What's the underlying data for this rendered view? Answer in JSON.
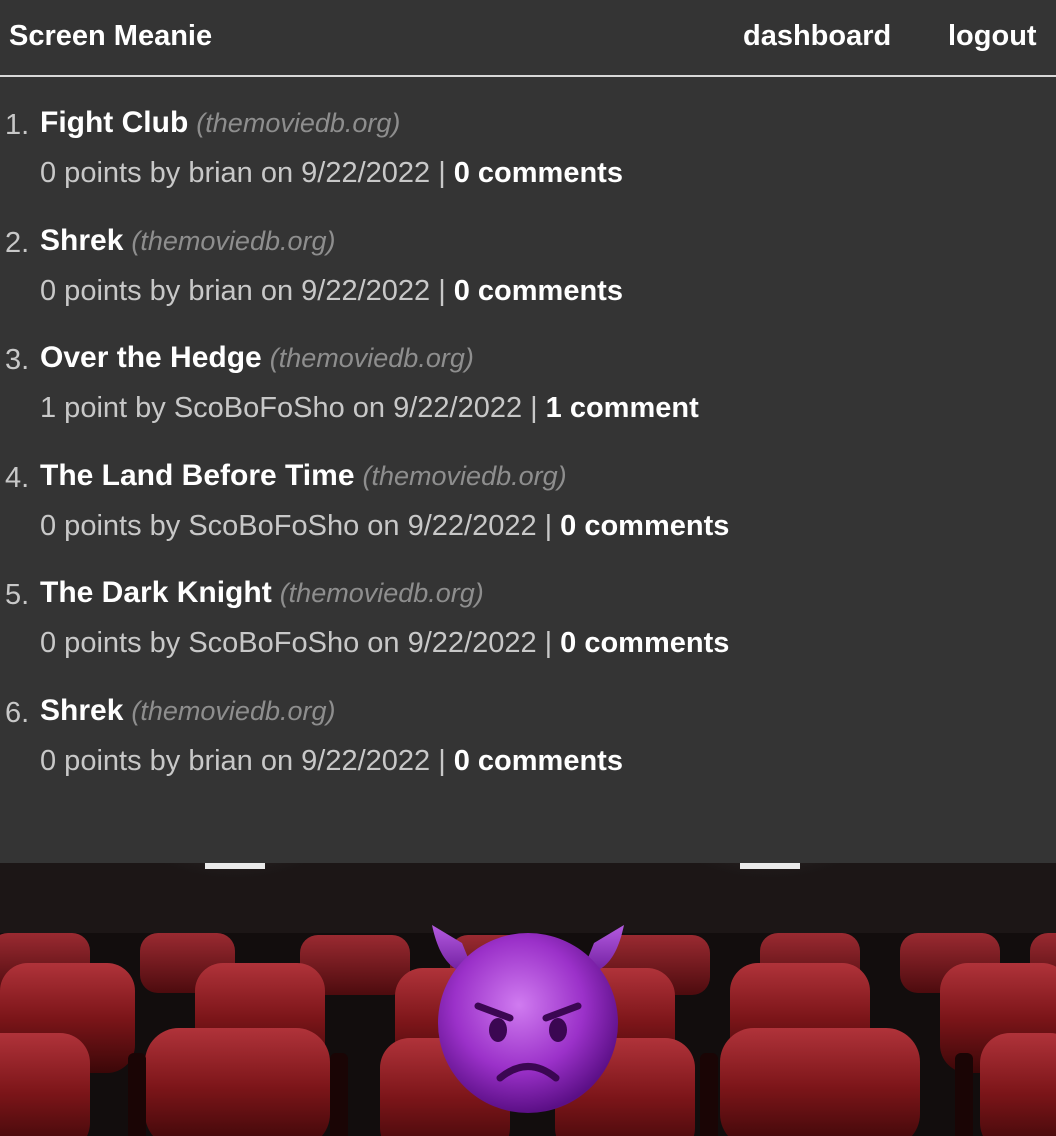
{
  "header": {
    "brand": "Screen Meanie",
    "nav": {
      "dashboard": "dashboard",
      "logout": "logout"
    }
  },
  "posts": [
    {
      "rank": "1.",
      "title": "Fight Club",
      "domain": "(themoviedb.org)",
      "meta": "0 points by brian on 9/22/2022",
      "separator": "|",
      "comments": "0 comments"
    },
    {
      "rank": "2.",
      "title": "Shrek",
      "domain": "(themoviedb.org)",
      "meta": "0 points by brian on 9/22/2022",
      "separator": "|",
      "comments": "0 comments"
    },
    {
      "rank": "3.",
      "title": "Over the Hedge",
      "domain": "(themoviedb.org)",
      "meta": "1 point by ScoBoFoSho on 9/22/2022",
      "separator": "|",
      "comments": "1 comment"
    },
    {
      "rank": "4.",
      "title": "The Land Before Time",
      "domain": "(themoviedb.org)",
      "meta": "0 points by ScoBoFoSho on 9/22/2022",
      "separator": "|",
      "comments": "0 comments"
    },
    {
      "rank": "5.",
      "title": "The Dark Knight",
      "domain": "(themoviedb.org)",
      "meta": "0 points by ScoBoFoSho on 9/22/2022",
      "separator": "|",
      "comments": "0 comments"
    },
    {
      "rank": "6.",
      "title": "Shrek",
      "domain": "(themoviedb.org)",
      "meta": "0 points by brian on 9/22/2022",
      "separator": "|",
      "comments": "0 comments"
    }
  ],
  "footer": {
    "image": "theater-seats-image",
    "emoji": "smiling-face-with-horns-icon"
  },
  "colors": {
    "background": "#343434",
    "text": "#ffffff",
    "muted": "#c8c8c8",
    "domain": "#8e8e8e",
    "seat_red": "#8a1a1e"
  }
}
